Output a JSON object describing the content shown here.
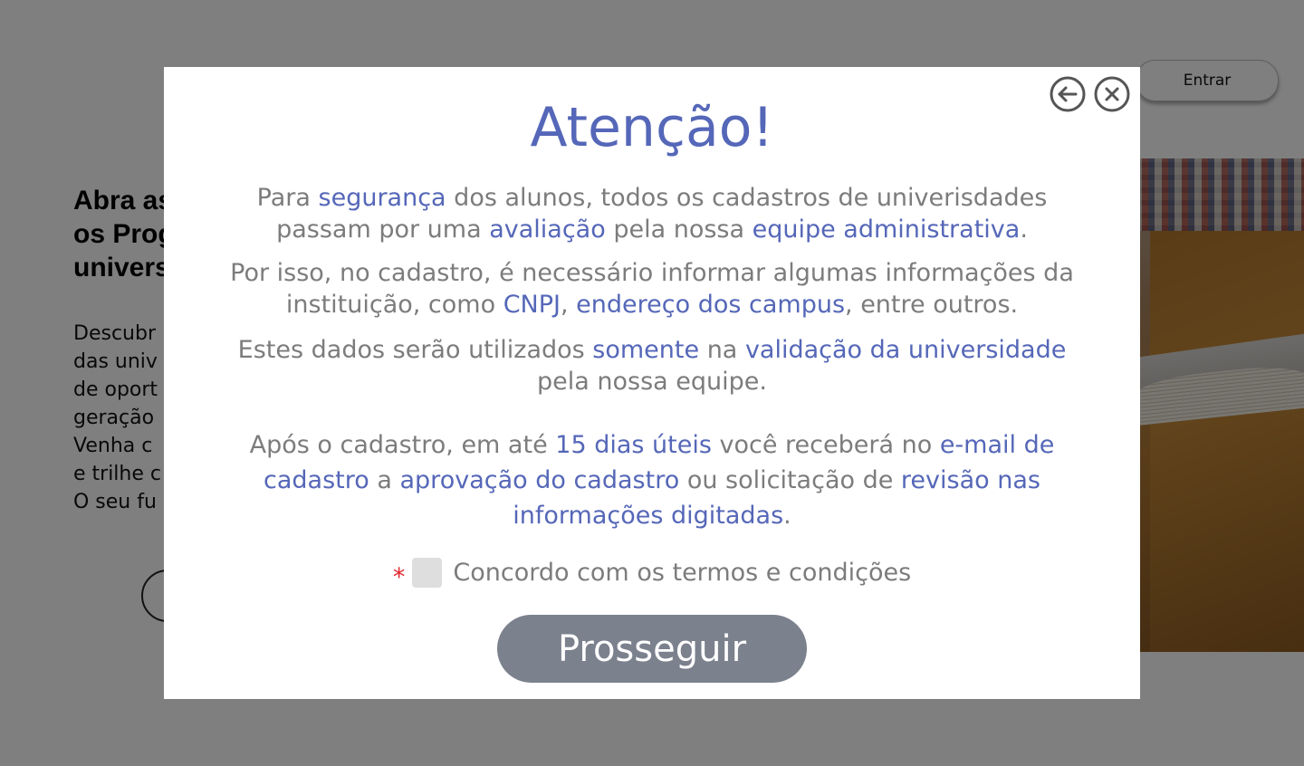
{
  "header": {
    "login_label": "Entrar"
  },
  "hero": {
    "title_lines": [
      "Abra as",
      "os Prog",
      "univers"
    ],
    "text_lines": [
      "Descubr",
      "das univ",
      "de oport",
      "geração",
      "Venha c",
      "e trilhe c",
      "O seu fu"
    ]
  },
  "modal": {
    "title": "Atenção!",
    "icons": {
      "back": "arrow-left-circle-icon",
      "close": "x-circle-icon"
    },
    "p1": {
      "t1": "Para ",
      "h1": "segurança",
      "t2": " dos alunos, todos os cadastros de univerisdades passam por uma ",
      "h2": "avaliação",
      "t3": " pela nossa ",
      "h3": "equipe administrativa",
      "t4": "."
    },
    "p2": {
      "t1": "Por isso, no cadastro, é necessário informar algumas informações da instituição, como ",
      "h1": "CNPJ",
      "t2": ", ",
      "h2": "endereço dos campus",
      "t3": ", entre outros."
    },
    "p3": {
      "t1": "Estes dados serão utilizados ",
      "h1": "somente",
      "t2": " na ",
      "h2": "validação da universidade",
      "t3": " pela nossa equipe."
    },
    "p4": {
      "t1": "Após o cadastro, em até ",
      "h1": "15 dias úteis",
      "t2": " você receberá no ",
      "h2": "e-mail de cadastro",
      "t3": " a ",
      "h3": "aprovação do cadastro",
      "t4": " ou solicitação de ",
      "h4": "revisão nas informações digitadas",
      "t5": "."
    },
    "required_mark": "*",
    "terms_label": "Concordo com os termos e condições",
    "terms_checked": false,
    "proceed_label": "Prosseguir"
  },
  "colors": {
    "accent": "#5567b8",
    "body_text": "#7c7c7c",
    "button_disabled": "#7b818d",
    "required": "#e0262b",
    "overlay": "rgba(0,0,0,0.5)"
  }
}
